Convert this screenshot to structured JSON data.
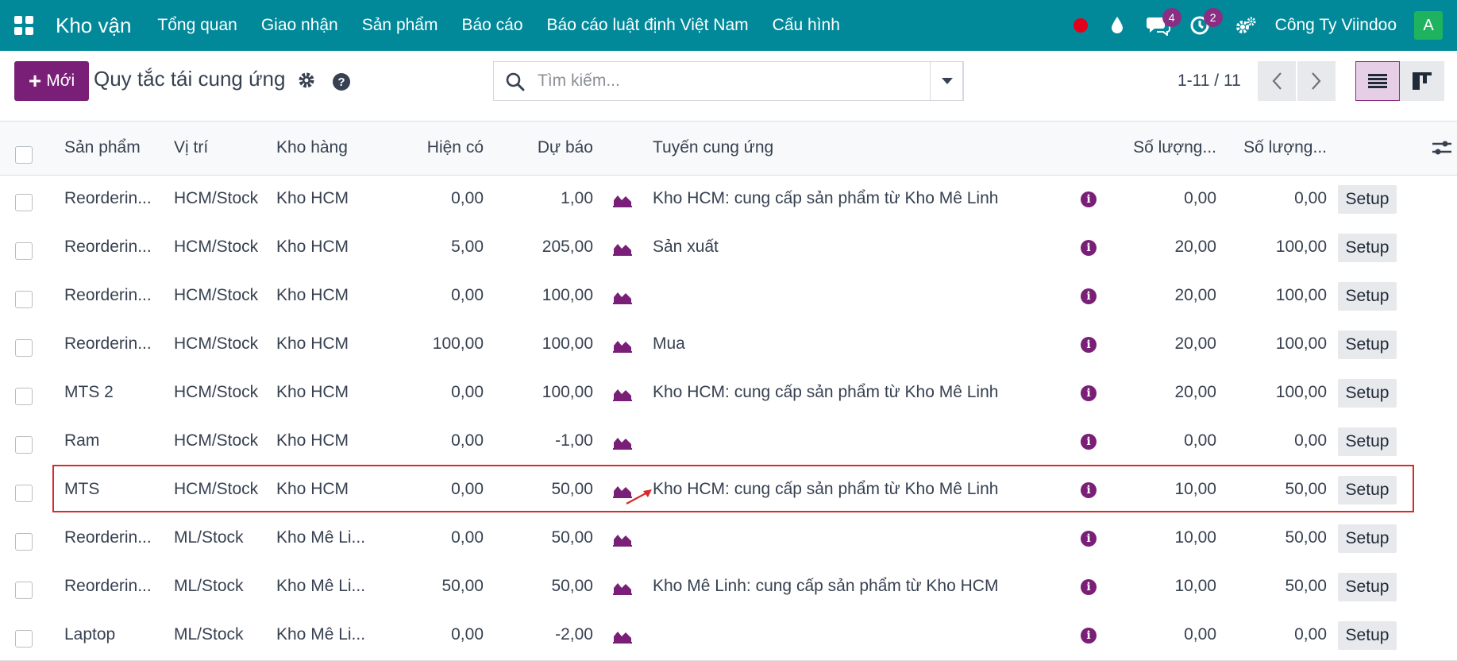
{
  "topbar": {
    "brand": "Kho vận",
    "menu": [
      "Tổng quan",
      "Giao nhận",
      "Sản phẩm",
      "Báo cáo",
      "Báo cáo luật định Việt Nam",
      "Cấu hình"
    ],
    "chat_count": "4",
    "activity_count": "2",
    "company": "Công Ty Viindoo",
    "avatar_letter": "A"
  },
  "control": {
    "new_label": "Mới",
    "title": "Quy tắc tái cung ứng",
    "search_placeholder": "Tìm kiếm...",
    "pager": "1-11 / 11"
  },
  "table": {
    "headers": {
      "product": "Sản phẩm",
      "location": "Vị trí",
      "warehouse": "Kho hàng",
      "on_hand": "Hiện có",
      "forecast": "Dự báo",
      "route": "Tuyến cung ứng",
      "min_qty": "Số lượng...",
      "max_qty": "Số lượng..."
    },
    "rows": [
      {
        "product": "Reorderin...",
        "location": "HCM/Stock",
        "warehouse": "Kho HCM",
        "on_hand": "0,00",
        "forecast": "1,00",
        "route": "Kho HCM: cung cấp sản phẩm từ Kho Mê Linh",
        "min_qty": "0,00",
        "max_qty": "0,00",
        "action": "Setup"
      },
      {
        "product": "Reorderin...",
        "location": "HCM/Stock",
        "warehouse": "Kho HCM",
        "on_hand": "5,00",
        "forecast": "205,00",
        "route": "Sản xuất",
        "min_qty": "20,00",
        "max_qty": "100,00",
        "action": "Setup"
      },
      {
        "product": "Reorderin...",
        "location": "HCM/Stock",
        "warehouse": "Kho HCM",
        "on_hand": "0,00",
        "forecast": "100,00",
        "route": "",
        "min_qty": "20,00",
        "max_qty": "100,00",
        "action": "Setup"
      },
      {
        "product": "Reorderin...",
        "location": "HCM/Stock",
        "warehouse": "Kho HCM",
        "on_hand": "100,00",
        "forecast": "100,00",
        "route": "Mua",
        "min_qty": "20,00",
        "max_qty": "100,00",
        "action": "Setup"
      },
      {
        "product": "MTS 2",
        "location": "HCM/Stock",
        "warehouse": "Kho HCM",
        "on_hand": "0,00",
        "forecast": "100,00",
        "route": "Kho HCM: cung cấp sản phẩm từ Kho Mê Linh",
        "min_qty": "20,00",
        "max_qty": "100,00",
        "action": "Setup"
      },
      {
        "product": "Ram",
        "location": "HCM/Stock",
        "warehouse": "Kho HCM",
        "on_hand": "0,00",
        "forecast": "-1,00",
        "route": "",
        "min_qty": "0,00",
        "max_qty": "0,00",
        "action": "Setup"
      },
      {
        "product": "MTS",
        "location": "HCM/Stock",
        "warehouse": "Kho HCM",
        "on_hand": "0,00",
        "forecast": "50,00",
        "route": "Kho HCM: cung cấp sản phẩm từ Kho Mê Linh",
        "min_qty": "10,00",
        "max_qty": "50,00",
        "action": "Setup"
      },
      {
        "product": "Reorderin...",
        "location": "ML/Stock",
        "warehouse": "Kho Mê Li...",
        "on_hand": "0,00",
        "forecast": "50,00",
        "route": "",
        "min_qty": "10,00",
        "max_qty": "50,00",
        "action": "Setup"
      },
      {
        "product": "Reorderin...",
        "location": "ML/Stock",
        "warehouse": "Kho Mê Li...",
        "on_hand": "50,00",
        "forecast": "50,00",
        "route": "Kho Mê Linh: cung cấp sản phẩm từ Kho HCM",
        "min_qty": "10,00",
        "max_qty": "50,00",
        "action": "Setup"
      },
      {
        "product": "Laptop",
        "location": "ML/Stock",
        "warehouse": "Kho Mê Li...",
        "on_hand": "0,00",
        "forecast": "-2,00",
        "route": "",
        "min_qty": "0,00",
        "max_qty": "0,00",
        "action": "Setup"
      }
    ]
  },
  "colors": {
    "topbar": "#01899a",
    "primary": "#7a1f77",
    "highlight_border": "#d62b2b"
  }
}
